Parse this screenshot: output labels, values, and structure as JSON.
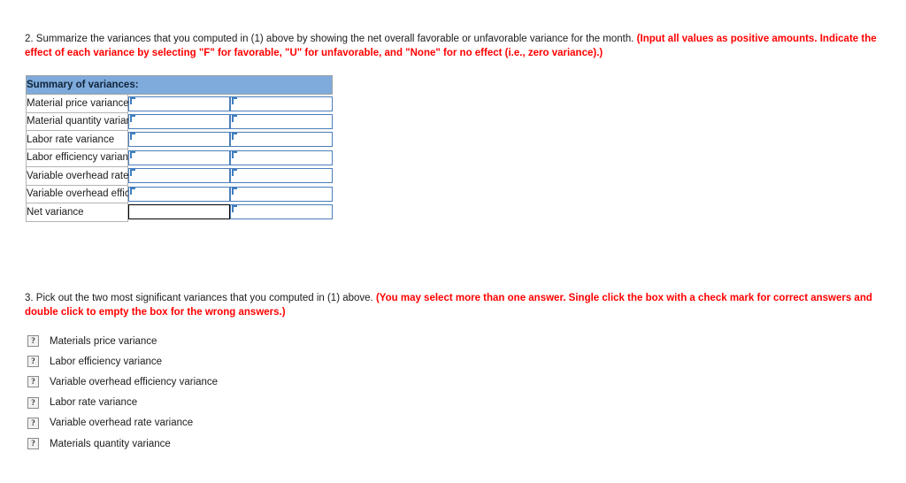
{
  "questions": {
    "q2": {
      "number": "2.",
      "text": "2. Summarize the variances that you computed in (1) above by showing the net overall favorable or unfavorable variance for the month. ",
      "note": "(Input all values as positive amounts. Indicate the effect of each variance by selecting \"F\" for favorable, \"U\" for unfavorable, and \"None\" for no effect (i.e., zero variance).)"
    },
    "q3": {
      "number": "3.",
      "text": "3. Pick out the two most significant variances that you computed in (1) above. ",
      "note": "(You may select more than one answer. Single click the box with a check mark for correct answers and double click to empty the box for the wrong answers.)"
    }
  },
  "summary_table": {
    "header": "Summary of variances:",
    "rows": [
      {
        "label": "Material price variance",
        "amount": "",
        "effect": "",
        "amount_style": "blue"
      },
      {
        "label": "Material quantity variance",
        "amount": "",
        "effect": "",
        "amount_style": "blue"
      },
      {
        "label": "Labor rate variance",
        "amount": "",
        "effect": "",
        "amount_style": "blue"
      },
      {
        "label": "Labor efficiency variance",
        "amount": "",
        "effect": "",
        "amount_style": "blue"
      },
      {
        "label": "Variable overhead rate variance",
        "amount": "",
        "effect": "",
        "amount_style": "blue"
      },
      {
        "label": "Variable overhead efficiency variance",
        "amount": "",
        "effect": "",
        "amount_style": "blue"
      },
      {
        "label": "Net variance",
        "amount": "",
        "effect": "",
        "amount_style": "plain"
      }
    ]
  },
  "choices": {
    "icon_name": "broken-image-placeholder-icon",
    "icon_glyph": "?",
    "items": [
      {
        "label": "Materials price variance",
        "checked": false
      },
      {
        "label": "Labor efficiency variance",
        "checked": false
      },
      {
        "label": "Variable overhead efficiency variance",
        "checked": false
      },
      {
        "label": "Labor rate variance",
        "checked": false
      },
      {
        "label": "Variable overhead rate variance",
        "checked": false
      },
      {
        "label": "Materials quantity variance",
        "checked": false
      }
    ]
  },
  "colors": {
    "header_blue": "#7EABDB",
    "field_border_blue": "#4a7ebb",
    "note_red": "#ff0000",
    "label_border_gray": "#b3b3b3",
    "page_background": "#ffffff"
  }
}
